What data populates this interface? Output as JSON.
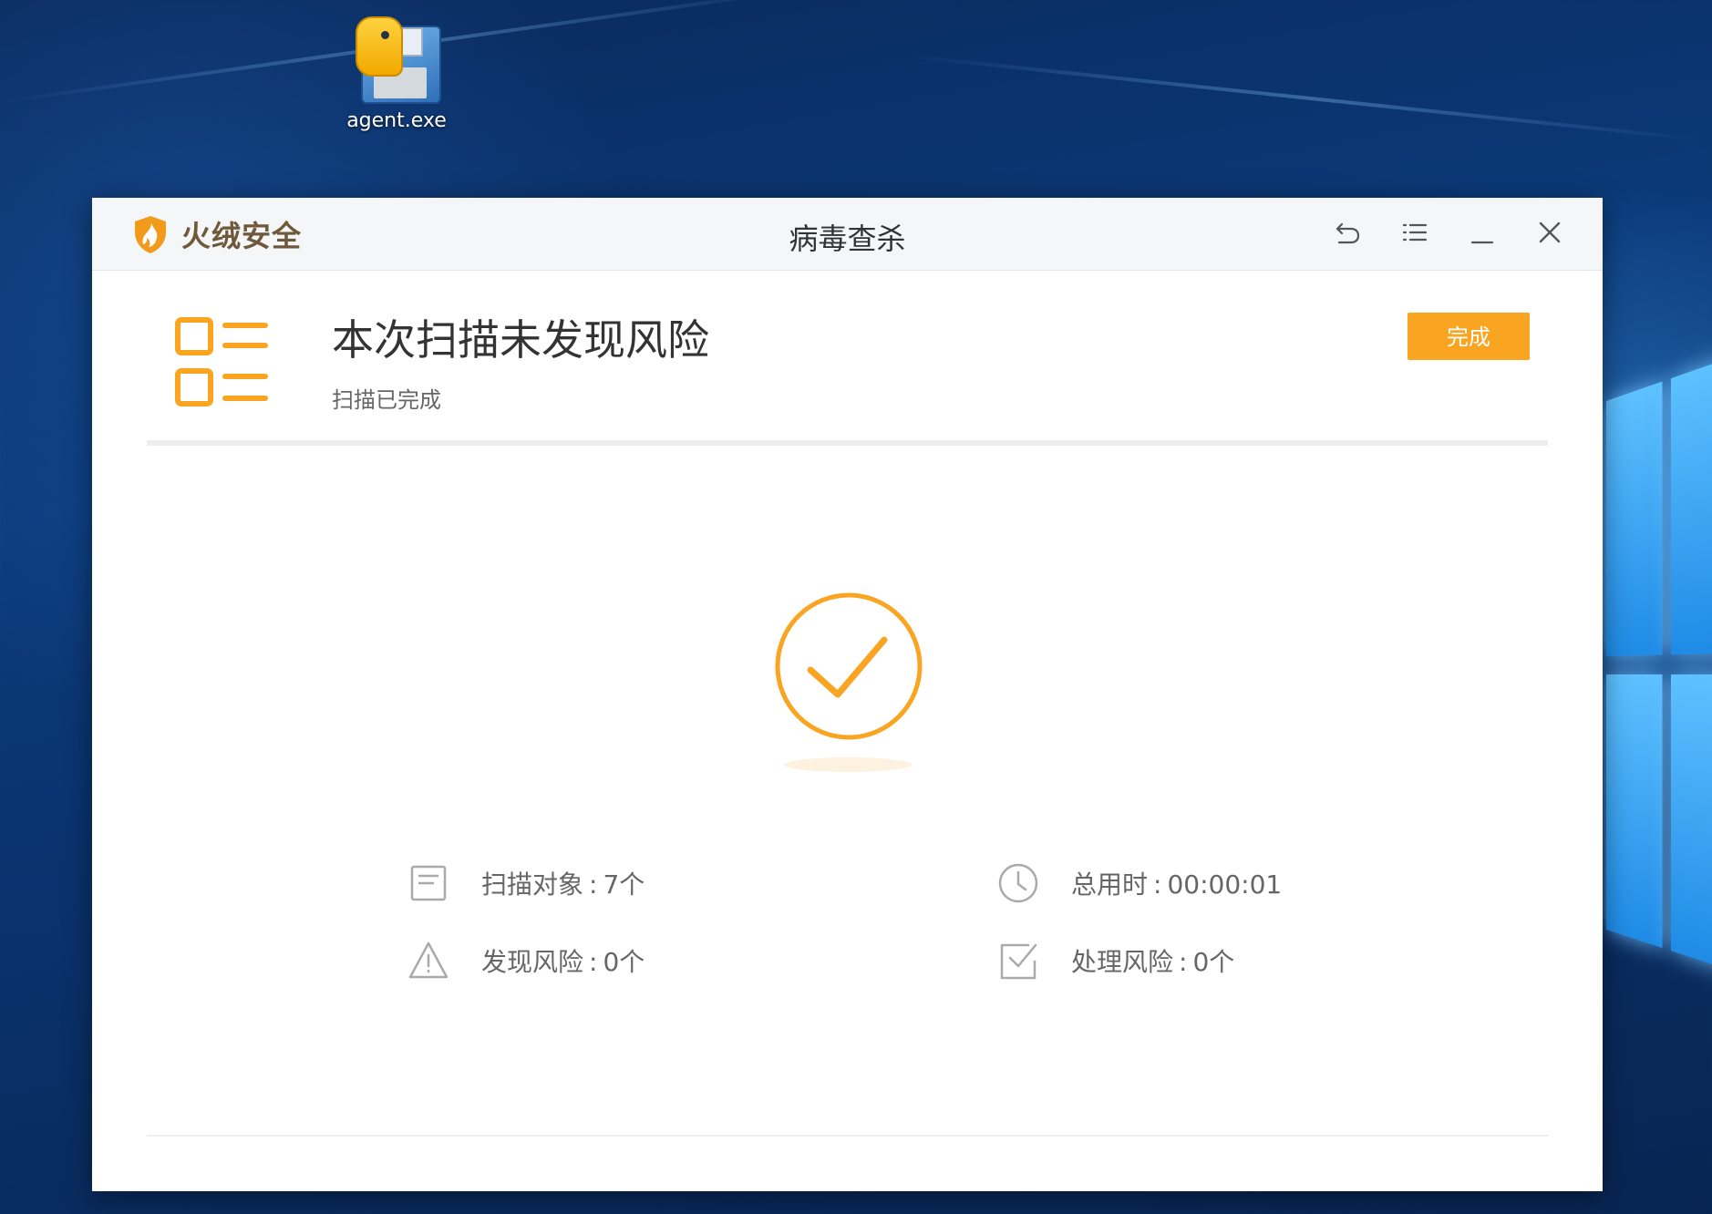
{
  "desktop": {
    "icon_label": "agent.exe"
  },
  "window": {
    "brand": "火绒安全",
    "title": "病毒查杀",
    "controls": {
      "back_icon": "back-arrow-icon",
      "menu_icon": "menu-icon",
      "minimize_icon": "minimize-icon",
      "close_icon": "close-icon"
    }
  },
  "result": {
    "title": "本次扫描未发现风险",
    "subtitle": "扫描已完成",
    "done_button": "完成"
  },
  "stats": {
    "scanned": {
      "label": "扫描对象",
      "value": "7个",
      "icon": "document-icon"
    },
    "elapsed": {
      "label": "总用时",
      "value": "00:00:01",
      "icon": "clock-icon"
    },
    "risks_found": {
      "label": "发现风险",
      "value": "0个",
      "icon": "warning-icon"
    },
    "risks_handled": {
      "label": "处理风险",
      "value": "0个",
      "icon": "checkbox-icon"
    }
  },
  "colors": {
    "accent": "#f9a521",
    "brand_text": "#6e5a3a",
    "desktop_bg": "#0b3a7a"
  }
}
